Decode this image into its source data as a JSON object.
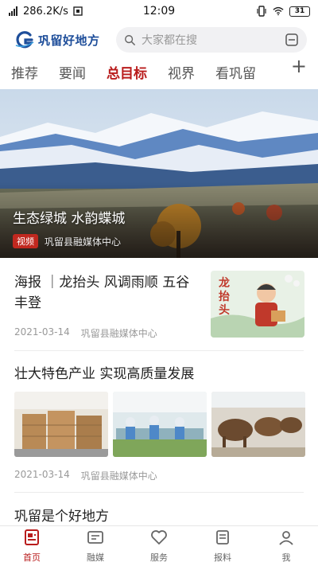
{
  "status_bar": {
    "network_speed": "286.2K/s",
    "time": "12:09",
    "battery": "31"
  },
  "header": {
    "logo_text": "巩留好地方",
    "search_placeholder": "大家都在搜"
  },
  "tabs": [
    {
      "label": "推荐",
      "active": false
    },
    {
      "label": "要闻",
      "active": false
    },
    {
      "label": "总目标",
      "active": true
    },
    {
      "label": "视界",
      "active": false
    },
    {
      "label": "看巩留",
      "active": false
    }
  ],
  "tab_add_label": "+",
  "hero": {
    "title": "生态绿城 水韵蝶城",
    "badge": "视频",
    "source": "巩留县融媒体中心"
  },
  "articles": [
    {
      "title": "海报 ｜龙抬头 风调雨顺 五谷丰登",
      "date": "2021-03-14",
      "source": "巩留县融媒体中心",
      "thumb_text": "龙抬头"
    },
    {
      "title": "壮大特色产业 实现高质量发展",
      "date": "2021-03-14",
      "source": "巩留县融媒体中心"
    },
    {
      "title": "巩留是个好地方"
    }
  ],
  "bottom_nav": [
    {
      "label": "首页",
      "icon": "home-icon",
      "active": true
    },
    {
      "label": "融媒",
      "icon": "media-icon",
      "active": false
    },
    {
      "label": "服务",
      "icon": "heart-service-icon",
      "active": false
    },
    {
      "label": "报料",
      "icon": "report-icon",
      "active": false
    },
    {
      "label": "我",
      "icon": "user-icon",
      "active": false
    }
  ],
  "colors": {
    "accent": "#b91c1c",
    "logo_blue": "#1e4e9a"
  }
}
